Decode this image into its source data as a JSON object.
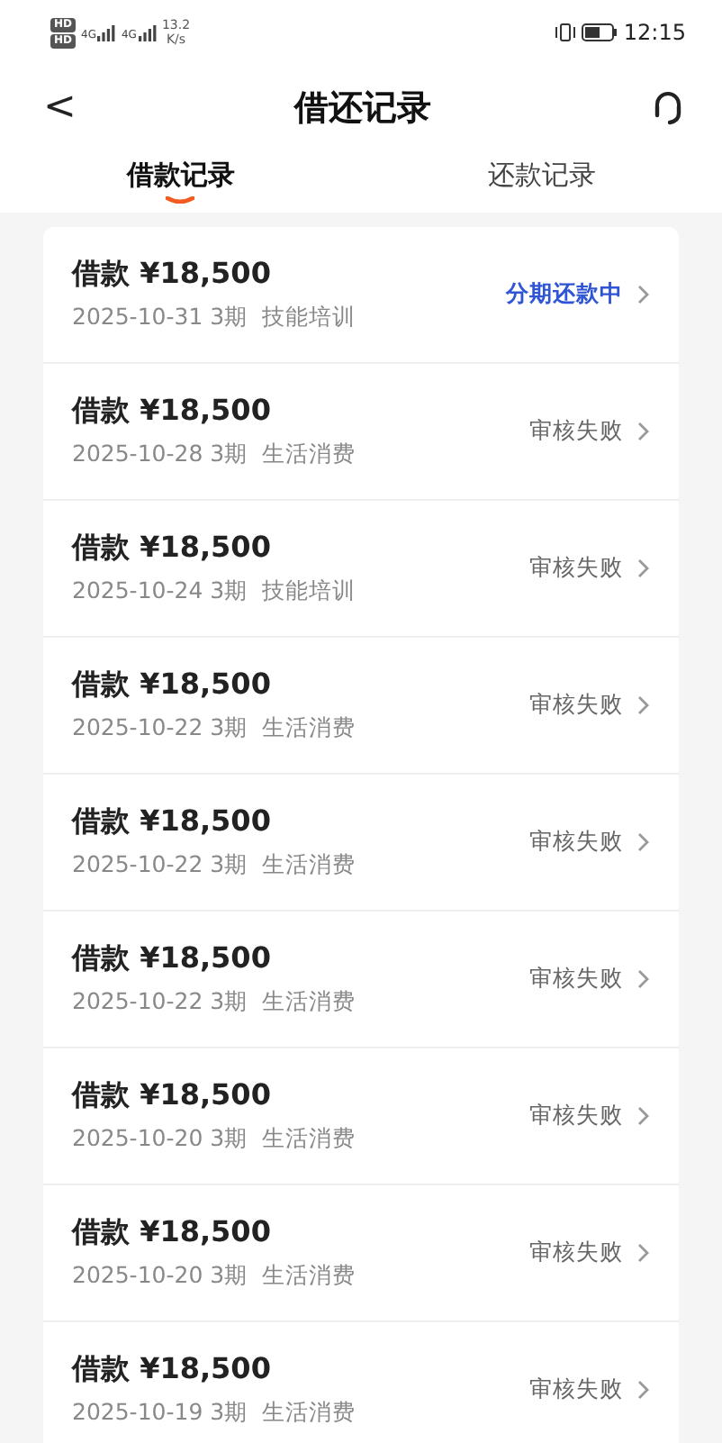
{
  "status_bar": {
    "sim_badges": [
      "HD",
      "HD"
    ],
    "networks": [
      "4G",
      "4G"
    ],
    "speed_value": "13.2",
    "speed_unit": "K/s",
    "time": "12:15"
  },
  "header": {
    "back": "<",
    "title": "借还记录"
  },
  "tabs": [
    {
      "label": "借款记录",
      "selected": true
    },
    {
      "label": "还款记录",
      "selected": false
    }
  ],
  "records": [
    {
      "title": "借款 ¥18,500",
      "detail": "2025-10-31 3期  技能培训",
      "status": "分期还款中",
      "kind": "active"
    },
    {
      "title": "借款 ¥18,500",
      "detail": "2025-10-28 3期  生活消费",
      "status": "审核失败",
      "kind": "failed"
    },
    {
      "title": "借款 ¥18,500",
      "detail": "2025-10-24 3期  技能培训",
      "status": "审核失败",
      "kind": "failed"
    },
    {
      "title": "借款 ¥18,500",
      "detail": "2025-10-22 3期  生活消费",
      "status": "审核失败",
      "kind": "failed"
    },
    {
      "title": "借款 ¥18,500",
      "detail": "2025-10-22 3期  生活消费",
      "status": "审核失败",
      "kind": "failed"
    },
    {
      "title": "借款 ¥18,500",
      "detail": "2025-10-22 3期  生活消费",
      "status": "审核失败",
      "kind": "failed"
    },
    {
      "title": "借款 ¥18,500",
      "detail": "2025-10-20 3期  生活消费",
      "status": "审核失败",
      "kind": "failed"
    },
    {
      "title": "借款 ¥18,500",
      "detail": "2025-10-20 3期  生活消费",
      "status": "审核失败",
      "kind": "failed"
    },
    {
      "title": "借款 ¥18,500",
      "detail": "2025-10-19 3期  生活消费",
      "status": "审核失败",
      "kind": "failed"
    }
  ]
}
